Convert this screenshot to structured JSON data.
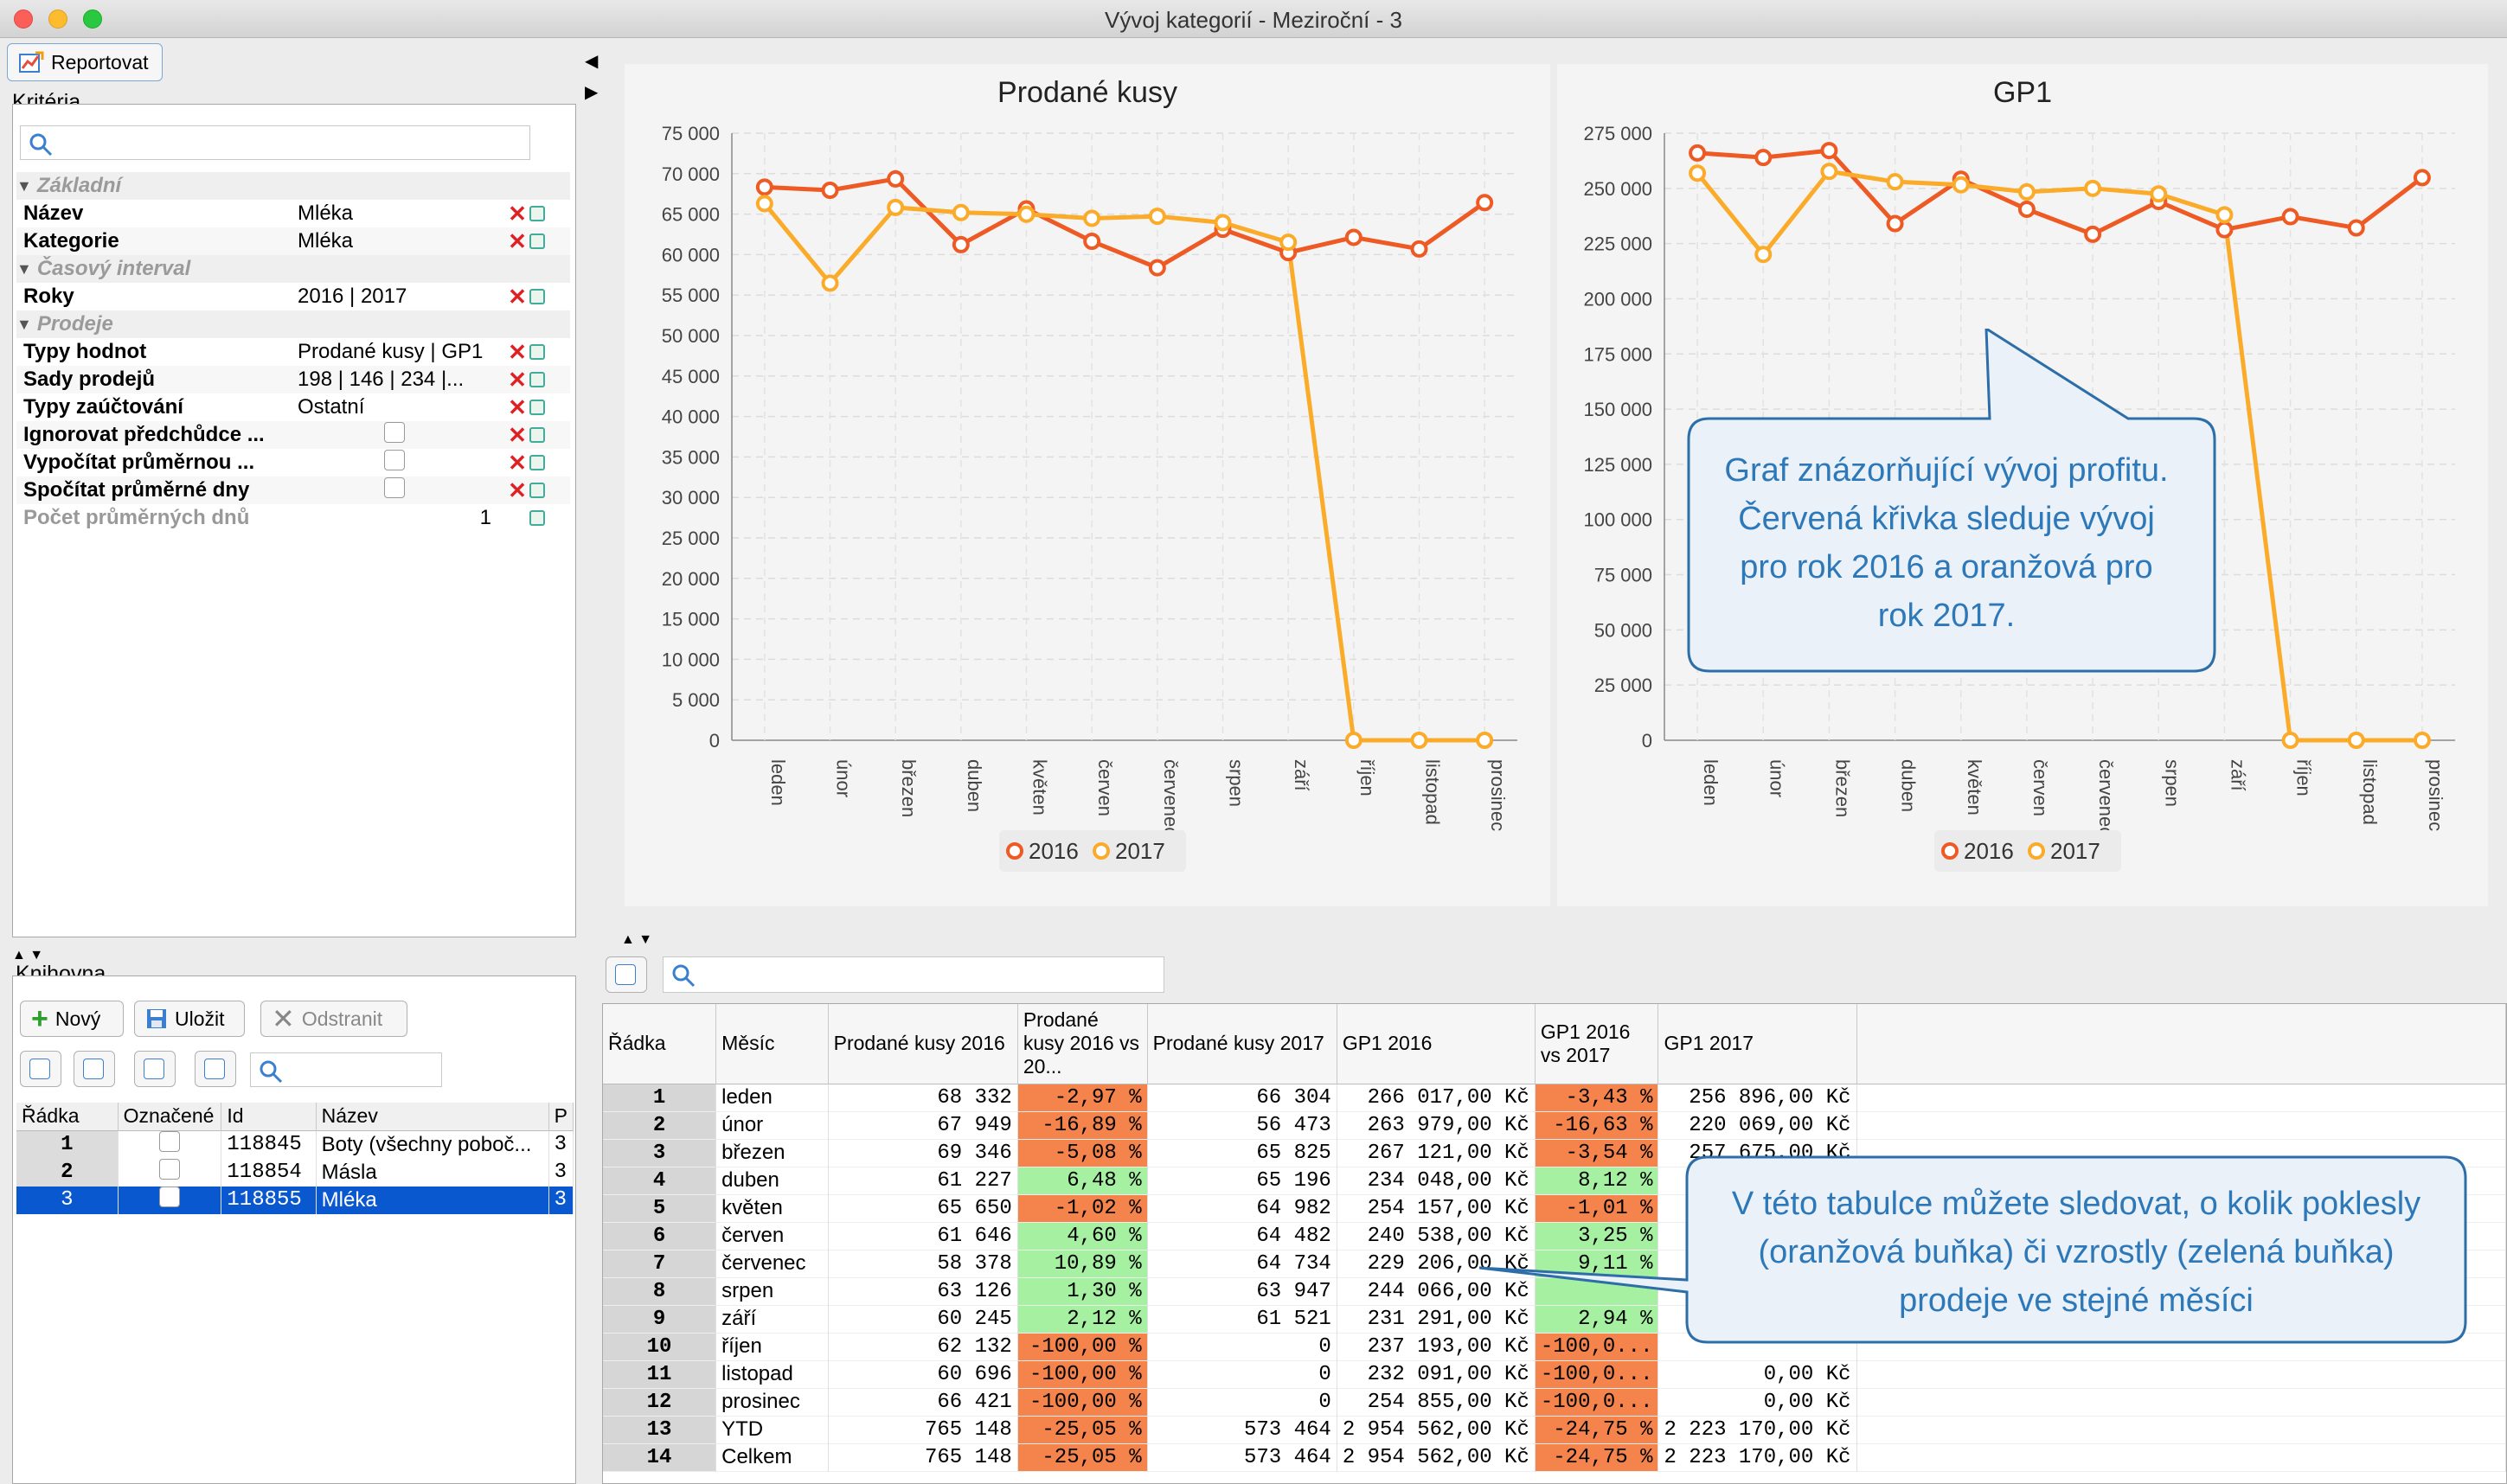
{
  "window": {
    "title": "Vývoj kategorií - Meziroční - 3"
  },
  "toolbar": {
    "report_label": "Reportovat"
  },
  "criteria": {
    "title": "Kritéria",
    "sections": [
      {
        "label": "Základní",
        "rows": [
          {
            "name": "Název",
            "value": "Mléka",
            "kind": "text"
          },
          {
            "name": "Kategorie",
            "value": "Mléka",
            "kind": "text"
          }
        ]
      },
      {
        "label": "Časový interval",
        "rows": [
          {
            "name": "Roky",
            "value": "2016 | 2017",
            "kind": "text"
          }
        ]
      },
      {
        "label": "Prodeje",
        "rows": [
          {
            "name": "Typy hodnot",
            "value": "Prodané kusy | GP1",
            "kind": "text"
          },
          {
            "name": "Sady prodejů",
            "value": "198 | 146 | 234 |...",
            "kind": "text"
          },
          {
            "name": "Typy zaúčtování",
            "value": "Ostatní",
            "kind": "text"
          },
          {
            "name": "Ignorovat předchůdce ...",
            "value": "",
            "kind": "check"
          },
          {
            "name": "Vypočítat průměrnou ...",
            "value": "",
            "kind": "check"
          },
          {
            "name": "Spočítat průměrné dny",
            "value": "",
            "kind": "check"
          },
          {
            "name": "Počet průměrných dnů",
            "value": "1",
            "kind": "disabled"
          }
        ]
      }
    ]
  },
  "library": {
    "title": "Knihovna",
    "new_label": "Nový",
    "save_label": "Uložit",
    "remove_label": "Odstranit",
    "columns": [
      "Řádka",
      "Označené",
      "Id",
      "Název",
      "P"
    ],
    "rows": [
      {
        "n": "1",
        "id": "118845",
        "name": "Boty (všechny poboč...",
        "p": "3",
        "selected": false
      },
      {
        "n": "2",
        "id": "118854",
        "name": "Másla",
        "p": "3",
        "selected": false
      },
      {
        "n": "3",
        "id": "118855",
        "name": "Mléka",
        "p": "3",
        "selected": true
      }
    ]
  },
  "months": [
    "leden",
    "únor",
    "březen",
    "duben",
    "květen",
    "červen",
    "červenec",
    "srpen",
    "září",
    "říjen",
    "listopad",
    "prosinec"
  ],
  "chart_data": [
    {
      "type": "line",
      "title": "Prodané kusy",
      "x": [
        "leden",
        "únor",
        "březen",
        "duben",
        "květen",
        "červen",
        "červenec",
        "srpen",
        "září",
        "říjen",
        "listopad",
        "prosinec"
      ],
      "ylim": [
        0,
        75000
      ],
      "yticks": [
        "0",
        "5 000",
        "10 000",
        "15 000",
        "20 000",
        "25 000",
        "30 000",
        "35 000",
        "40 000",
        "45 000",
        "50 000",
        "55 000",
        "60 000",
        "65 000",
        "70 000",
        "75 000"
      ],
      "grid": true,
      "legend": "bottom",
      "series": [
        {
          "name": "2016",
          "color": "#ee5a24",
          "values": [
            68332,
            67949,
            69346,
            61227,
            65650,
            61646,
            58378,
            63126,
            60245,
            62132,
            60696,
            66421
          ]
        },
        {
          "name": "2017",
          "color": "#fbab2a",
          "values": [
            66304,
            56473,
            65825,
            65196,
            64982,
            64482,
            64734,
            63947,
            61521,
            0,
            0,
            0
          ]
        }
      ]
    },
    {
      "type": "line",
      "title": "GP1",
      "x": [
        "leden",
        "únor",
        "březen",
        "duben",
        "květen",
        "červen",
        "červenec",
        "srpen",
        "září",
        "říjen",
        "listopad",
        "prosinec"
      ],
      "ylim": [
        0,
        275000
      ],
      "yticks": [
        "0",
        "25 000",
        "50 000",
        "75 000",
        "100 000",
        "125 000",
        "150 000",
        "175 000",
        "200 000",
        "225 000",
        "250 000",
        "275 000"
      ],
      "grid": true,
      "legend": "bottom",
      "series": [
        {
          "name": "2016",
          "color": "#ee5a24",
          "values": [
            266017,
            263979,
            267121,
            234048,
            254157,
            240538,
            229206,
            244066,
            231291,
            237193,
            232091,
            254855
          ]
        },
        {
          "name": "2017",
          "color": "#fbab2a",
          "values": [
            256896,
            220069,
            257675,
            253000,
            251600,
            248400,
            250000,
            247500,
            238000,
            0,
            0,
            0
          ]
        }
      ]
    }
  ],
  "callouts": {
    "chart": "Graf znázorňující vývoj profitu. Červená křivka sleduje vývoj pro rok 2016 a oranžová pro rok 2017.",
    "table": "V této tabulce můžete sledovat, o kolik poklesly (oranžová buňka) či vzrostly (zelená buňka) prodeje ve stejné měsíci"
  },
  "table": {
    "headers": [
      "Řádka",
      "Měsíc",
      "Prodané kusy 2016",
      "Prodané kusy 2016 vs 20...",
      "Prodané kusy 2017",
      "GP1 2016",
      "GP1 2016 vs 2017",
      "GP1 2017"
    ],
    "rows": [
      {
        "n": "1",
        "m": "leden",
        "pk16": "68 332",
        "d1": "-2,97 %",
        "s1": "neg",
        "pk17": "66 304",
        "gp16": "266 017,00 Kč",
        "d2": "-3,43 %",
        "s2": "neg",
        "gp17": "256 896,00 Kč"
      },
      {
        "n": "2",
        "m": "únor",
        "pk16": "67 949",
        "d1": "-16,89 %",
        "s1": "neg",
        "pk17": "56 473",
        "gp16": "263 979,00 Kč",
        "d2": "-16,63 %",
        "s2": "neg",
        "gp17": "220 069,00 Kč"
      },
      {
        "n": "3",
        "m": "březen",
        "pk16": "69 346",
        "d1": "-5,08 %",
        "s1": "neg",
        "pk17": "65 825",
        "gp16": "267 121,00 Kč",
        "d2": "-3,54 %",
        "s2": "neg",
        "gp17": "257 675,00 Kč"
      },
      {
        "n": "4",
        "m": "duben",
        "pk16": "61 227",
        "d1": "6,48 %",
        "s1": "pos",
        "pk17": "65 196",
        "gp16": "234 048,00 Kč",
        "d2": "8,12 %",
        "s2": "pos",
        "gp17": "2"
      },
      {
        "n": "5",
        "m": "květen",
        "pk16": "65 650",
        "d1": "-1,02 %",
        "s1": "neg",
        "pk17": "64 982",
        "gp16": "254 157,00 Kč",
        "d2": "-1,01 %",
        "s2": "neg",
        "gp17": "2"
      },
      {
        "n": "6",
        "m": "červen",
        "pk16": "61 646",
        "d1": "4,60 %",
        "s1": "pos",
        "pk17": "64 482",
        "gp16": "240 538,00 Kč",
        "d2": "3,25 %",
        "s2": "pos",
        "gp17": "2"
      },
      {
        "n": "7",
        "m": "červenec",
        "pk16": "58 378",
        "d1": "10,89 %",
        "s1": "pos",
        "pk17": "64 734",
        "gp16": "229 206,00 Kč",
        "d2": "9,11 %",
        "s2": "pos",
        "gp17": "2"
      },
      {
        "n": "8",
        "m": "srpen",
        "pk16": "63 126",
        "d1": "1,30 %",
        "s1": "pos",
        "pk17": "63 947",
        "gp16": "244 066,00 Kč",
        "d2": "",
        "s2": "pos",
        "gp17": ""
      },
      {
        "n": "9",
        "m": "září",
        "pk16": "60 245",
        "d1": "2,12 %",
        "s1": "pos",
        "pk17": "61 521",
        "gp16": "231 291,00 Kč",
        "d2": "2,94 %",
        "s2": "pos",
        "gp17": ""
      },
      {
        "n": "10",
        "m": "říjen",
        "pk16": "62 132",
        "d1": "-100,00 %",
        "s1": "neg",
        "pk17": "0",
        "gp16": "237 193,00 Kč",
        "d2": "-100,0...",
        "s2": "neg",
        "gp17": ""
      },
      {
        "n": "11",
        "m": "listopad",
        "pk16": "60 696",
        "d1": "-100,00 %",
        "s1": "neg",
        "pk17": "0",
        "gp16": "232 091,00 Kč",
        "d2": "-100,0...",
        "s2": "neg",
        "gp17": "0,00 Kč"
      },
      {
        "n": "12",
        "m": "prosinec",
        "pk16": "66 421",
        "d1": "-100,00 %",
        "s1": "neg",
        "pk17": "0",
        "gp16": "254 855,00 Kč",
        "d2": "-100,0...",
        "s2": "neg",
        "gp17": "0,00 Kč"
      },
      {
        "n": "13",
        "m": "YTD",
        "pk16": "765 148",
        "d1": "-25,05 %",
        "s1": "neg",
        "pk17": "573 464",
        "gp16": "2 954 562,00 Kč",
        "d2": "-24,75 %",
        "s2": "neg",
        "gp17": "2 223 170,00 Kč"
      },
      {
        "n": "14",
        "m": "Celkem",
        "pk16": "765 148",
        "d1": "-25,05 %",
        "s1": "neg",
        "pk17": "573 464",
        "gp16": "2 954 562,00 Kč",
        "d2": "-24,75 %",
        "s2": "neg",
        "gp17": "2 223 170,00 Kč"
      }
    ]
  }
}
